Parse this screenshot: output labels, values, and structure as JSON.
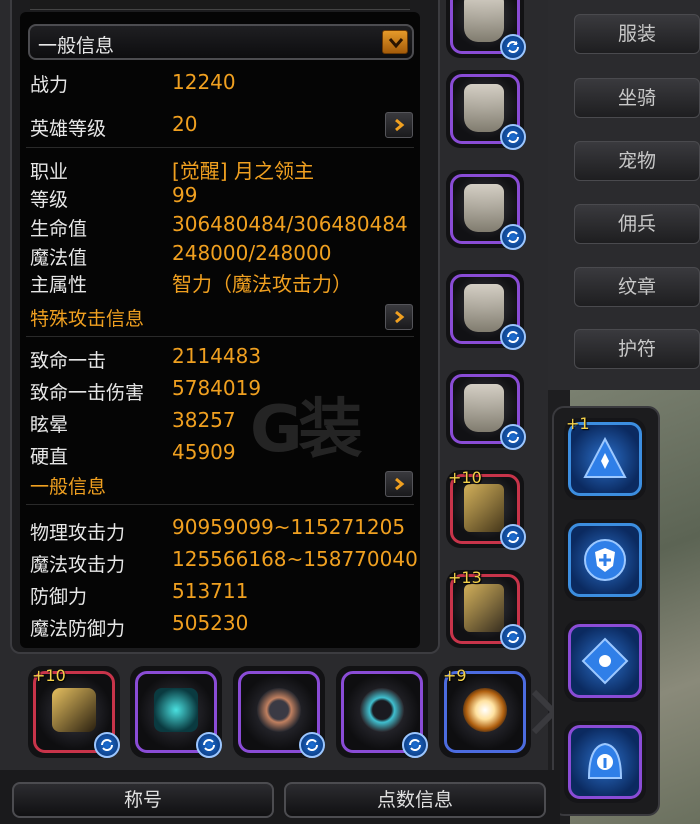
{
  "general_dropdown": {
    "selected": "一般信息"
  },
  "basic_stats": [
    {
      "label": "战力",
      "value": "12240"
    },
    {
      "label": "英雄等级",
      "value": "20"
    }
  ],
  "profile": [
    {
      "label": "职业",
      "value": "[觉醒] 月之领主"
    },
    {
      "label": "等级",
      "value": "99"
    },
    {
      "label": "生命值",
      "value": "306480484/306480484"
    },
    {
      "label": "魔法值",
      "value": "248000/248000"
    },
    {
      "label": "主属性",
      "value": "智力（魔法攻击力）"
    }
  ],
  "special_attack": {
    "title": "特殊攻击信息",
    "stats": [
      {
        "label": "致命一击",
        "value": "2114483"
      },
      {
        "label": "致命一击伤害",
        "value": "5784019"
      },
      {
        "label": "眩晕",
        "value": "38257"
      },
      {
        "label": "硬直",
        "value": "45909"
      }
    ]
  },
  "general_info": {
    "title": "一般信息",
    "stats": [
      {
        "label": "物理攻击力",
        "value": "90959099~115271205"
      },
      {
        "label": "魔法攻击力",
        "value": "125566168~158770040"
      },
      {
        "label": "防御力",
        "value": "513711"
      },
      {
        "label": "魔法防御力",
        "value": "505230"
      }
    ]
  },
  "equipment_slots": [
    {
      "name": "helmet",
      "plus": ""
    },
    {
      "name": "chest-armor",
      "plus": ""
    },
    {
      "name": "pants",
      "plus": ""
    },
    {
      "name": "gloves",
      "plus": ""
    },
    {
      "name": "boots",
      "plus": ""
    },
    {
      "name": "main-weapon",
      "plus": "+10"
    },
    {
      "name": "offhand-weapon",
      "plus": "+13"
    }
  ],
  "accessory_slots": [
    {
      "name": "necklace",
      "plus": "+10"
    },
    {
      "name": "wings",
      "plus": ""
    },
    {
      "name": "ring-left",
      "plus": ""
    },
    {
      "name": "ring-right",
      "plus": ""
    },
    {
      "name": "orb",
      "plus": "+9"
    }
  ],
  "crest_slots": [
    {
      "name": "crest-1",
      "plus": "+1"
    },
    {
      "name": "crest-2",
      "plus": ""
    },
    {
      "name": "crest-3",
      "plus": ""
    },
    {
      "name": "crest-4",
      "plus": ""
    }
  ],
  "side_menu": [
    "服装",
    "坐骑",
    "宠物",
    "佣兵",
    "纹章",
    "护符"
  ],
  "bottom_buttons": {
    "title": "称号",
    "points": "点数信息"
  },
  "watermark": "G装",
  "colors": {
    "value": "#f0a020",
    "label": "#e6e6e6",
    "epic": "#8a4cd6",
    "legend": "#c8344a",
    "crest": "#3c8ee0"
  }
}
